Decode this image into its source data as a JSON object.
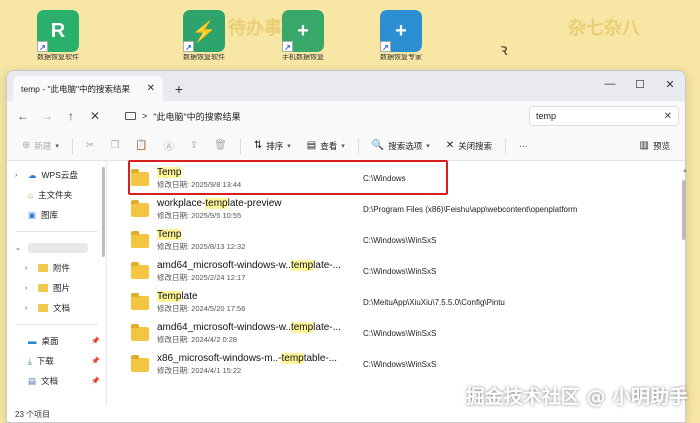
{
  "desktop": {
    "deco_left": "待办事",
    "deco_right": "杂七杂八",
    "icons": [
      {
        "caption": "数据恢复软件",
        "glyph": "R",
        "color": "#2bb06b"
      },
      {
        "caption": "数据恢复软件",
        "glyph": "⚡",
        "color": "#2ea36b"
      },
      {
        "caption": "手机数据恢复",
        "glyph": "+",
        "color": "#37a86a"
      },
      {
        "caption": "数据恢复专家",
        "glyph": "+",
        "color": "#2b8fd1"
      }
    ]
  },
  "window": {
    "tab_title": "temp - \"此电脑\"中的搜索结果",
    "tab_close": "✕",
    "new_tab": "+",
    "controls": {
      "minimize": "—",
      "maximize": "☐",
      "close": "✕"
    }
  },
  "navbar": {
    "back": "←",
    "forward": "→",
    "up": "↑",
    "stop": "✕",
    "breadcrumb_sep": ">",
    "breadcrumb": "\"此电脑\"中的搜索结果",
    "search_value": "temp",
    "search_clear": "✕"
  },
  "commandbar": {
    "new": "新建",
    "sort": "排序",
    "view": "查看",
    "search_options": "搜索选项",
    "close_search": "关闭搜索",
    "more": "···",
    "preview": "预览"
  },
  "sidebar": {
    "items": [
      {
        "label": "WPS云盘",
        "icon": "cloud-icon"
      },
      {
        "label": "主文件夹",
        "icon": "home-icon"
      },
      {
        "label": "图库",
        "icon": "gallery-icon"
      },
      {
        "label": "附件",
        "icon": "folder-icon"
      },
      {
        "label": "图片",
        "icon": "folder-icon"
      },
      {
        "label": "文档",
        "icon": "folder-icon"
      },
      {
        "label": "桌面",
        "icon": "desktop-icon"
      },
      {
        "label": "下载",
        "icon": "download-icon"
      },
      {
        "label": "文档",
        "icon": "document-icon"
      }
    ],
    "pin": "📌"
  },
  "results": [
    {
      "pre": "",
      "hl": "Temp",
      "post": "",
      "meta": "修改日期: 2025/9/8 13:44",
      "path": "C:\\Windows"
    },
    {
      "pre": "workplace-",
      "hl": "temp",
      "post": "late-preview",
      "meta": "修改日期: 2025/9/5 10:55",
      "path": "D:\\Program Files (x86)\\Feishu\\app\\webcontent\\openplatform"
    },
    {
      "pre": "",
      "hl": "Temp",
      "post": "",
      "meta": "修改日期: 2025/8/13 12:32",
      "path": "C:\\Windows\\WinSxS"
    },
    {
      "pre": "amd64_microsoft-windows-w..",
      "hl": "temp",
      "post": "late-...",
      "meta": "修改日期: 2025/2/24 12:17",
      "path": "C:\\Windows\\WinSxS"
    },
    {
      "pre": "",
      "hl": "Temp",
      "post": "late",
      "meta": "修改日期: 2024/5/20 17:56",
      "path": "D:\\MeituApp\\XiuXiu\\7.5.5.0\\Config\\Pintu"
    },
    {
      "pre": "amd64_microsoft-windows-w..",
      "hl": "temp",
      "post": "late-...",
      "meta": "修改日期: 2024/4/2 0:28",
      "path": "C:\\Windows\\WinSxS"
    },
    {
      "pre": "x86_microsoft-windows-m..-",
      "hl": "temp",
      "post": "table-...",
      "meta": "修改日期: 2024/4/1 15:22",
      "path": "C:\\Windows\\WinSxS"
    }
  ],
  "statusbar": {
    "count": "23 个项目"
  },
  "watermark": "掘金技术社区 @ 小明助手"
}
